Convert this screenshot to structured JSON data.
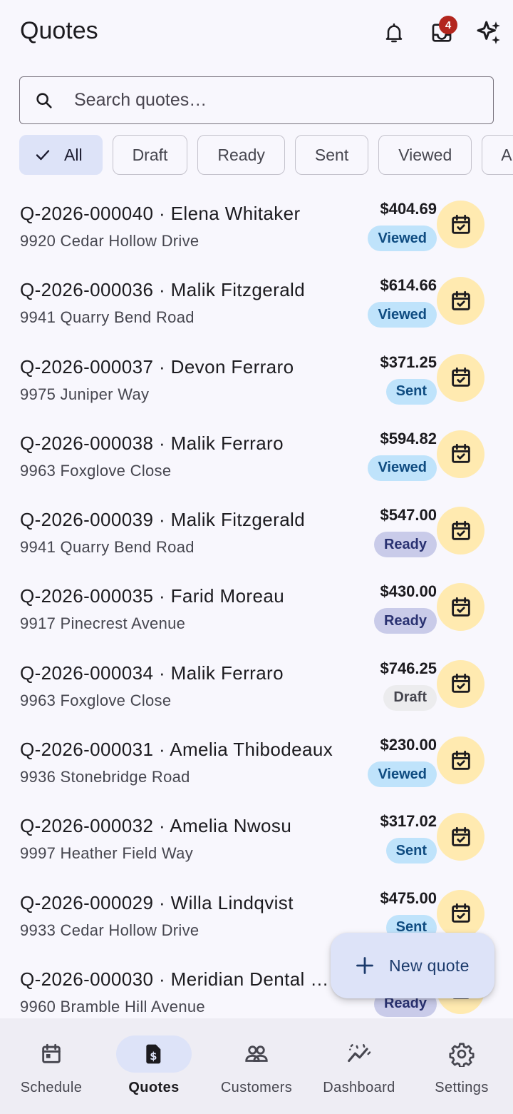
{
  "app_bar": {
    "title": "Quotes",
    "notification_icon": "bell-icon",
    "inbox_icon": "inbox-icon",
    "inbox_badge": "4",
    "ai_icon": "sparkle-icon"
  },
  "search": {
    "placeholder": "Search quotes…",
    "value": ""
  },
  "filters": [
    {
      "label": "All",
      "selected": true
    },
    {
      "label": "Draft",
      "selected": false
    },
    {
      "label": "Ready",
      "selected": false
    },
    {
      "label": "Sent",
      "selected": false
    },
    {
      "label": "Viewed",
      "selected": false
    },
    {
      "label": "A",
      "selected": false
    }
  ],
  "quotes": [
    {
      "title": "Q-2026-000040 · Elena Whitaker",
      "address": "9920 Cedar Hollow Drive",
      "amount": "$404.69",
      "status": "Viewed"
    },
    {
      "title": "Q-2026-000036 · Malik Fitzgerald",
      "address": "9941 Quarry Bend Road",
      "amount": "$614.66",
      "status": "Viewed"
    },
    {
      "title": "Q-2026-000037 · Devon Ferraro",
      "address": "9975 Juniper Way",
      "amount": "$371.25",
      "status": "Sent"
    },
    {
      "title": "Q-2026-000038 · Malik Ferraro",
      "address": "9963 Foxglove Close",
      "amount": "$594.82",
      "status": "Viewed"
    },
    {
      "title": "Q-2026-000039 · Malik Fitzgerald",
      "address": "9941 Quarry Bend Road",
      "amount": "$547.00",
      "status": "Ready"
    },
    {
      "title": "Q-2026-000035 · Farid Moreau",
      "address": "9917 Pinecrest Avenue",
      "amount": "$430.00",
      "status": "Ready"
    },
    {
      "title": "Q-2026-000034 · Malik Ferraro",
      "address": "9963 Foxglove Close",
      "amount": "$746.25",
      "status": "Draft"
    },
    {
      "title": "Q-2026-000031 · Amelia Thibodeaux",
      "address": "9936 Stonebridge Road",
      "amount": "$230.00",
      "status": "Viewed"
    },
    {
      "title": "Q-2026-000032 · Amelia Nwosu",
      "address": "9997 Heather Field Way",
      "amount": "$317.02",
      "status": "Sent"
    },
    {
      "title": "Q-2026-000029 · Willa Lindqvist",
      "address": "9933 Cedar Hollow Drive",
      "amount": "$475.00",
      "status": "Sent"
    },
    {
      "title": "Q-2026-000030 · Meridian Dental …",
      "address": "9960 Bramble Hill Avenue",
      "amount": "",
      "status": "Ready"
    }
  ],
  "fab": {
    "label": "New quote",
    "icon": "plus-icon"
  },
  "nav": [
    {
      "label": "Schedule",
      "icon": "calendar-icon",
      "active": false
    },
    {
      "label": "Quotes",
      "icon": "invoice-icon",
      "active": true
    },
    {
      "label": "Customers",
      "icon": "people-icon",
      "active": false
    },
    {
      "label": "Dashboard",
      "icon": "trending-icon",
      "active": false
    },
    {
      "label": "Settings",
      "icon": "gear-icon",
      "active": false
    }
  ],
  "colors": {
    "status_viewed": "#bfe3fb",
    "status_ready": "#c9cbe9",
    "status_draft": "#ececee",
    "calendar_circle": "#ffeab0",
    "accent": "#dde3f8",
    "badge": "#b3261e"
  }
}
